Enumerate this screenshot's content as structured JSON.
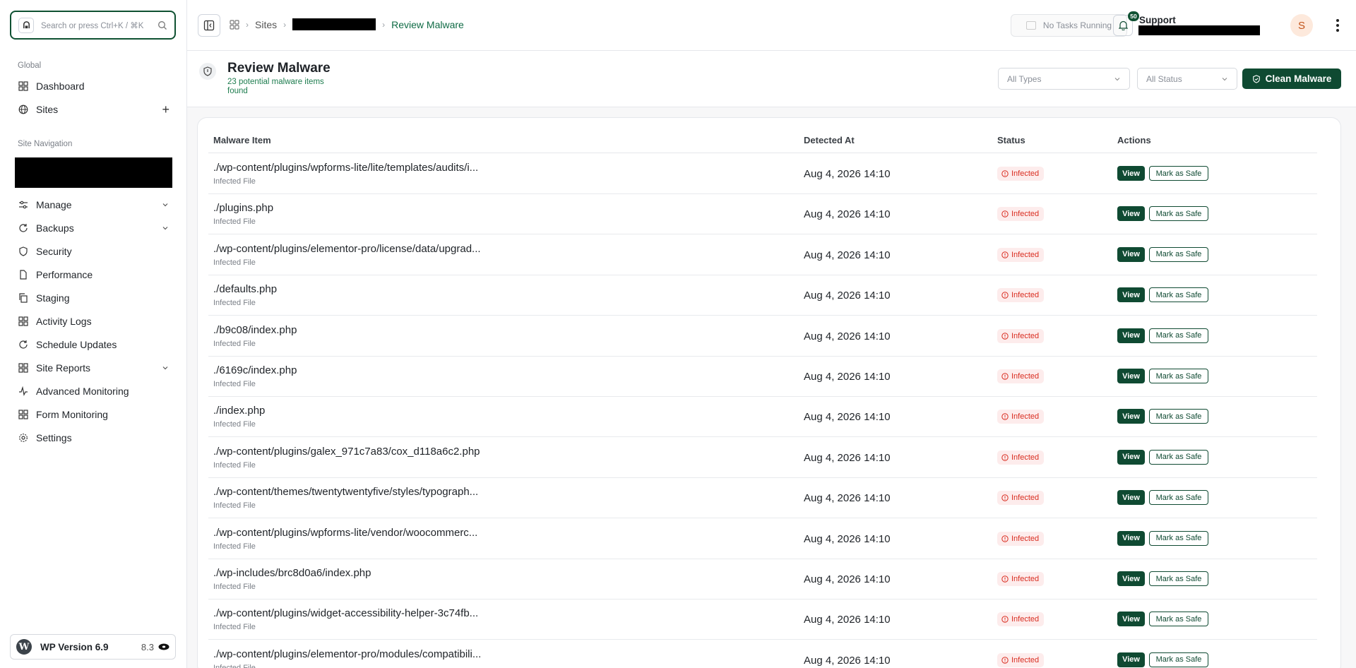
{
  "search": {
    "placeholder": "Search or press Ctrl+K / ⌘K"
  },
  "sidebar": {
    "global_label": "Global",
    "global_items": [
      {
        "label": "Dashboard",
        "icon": "grid-icon"
      },
      {
        "label": "Sites",
        "icon": "globe-icon",
        "action": "+"
      }
    ],
    "site_nav_label": "Site Navigation",
    "items": [
      {
        "label": "Manage",
        "icon": "sliders-icon",
        "expandable": true
      },
      {
        "label": "Backups",
        "icon": "refresh-icon",
        "expandable": true
      },
      {
        "label": "Security",
        "icon": "shield-icon"
      },
      {
        "label": "Performance",
        "icon": "document-icon"
      },
      {
        "label": "Staging",
        "icon": "copy-icon"
      },
      {
        "label": "Activity Logs",
        "icon": "grid-icon"
      },
      {
        "label": "Schedule Updates",
        "icon": "refresh-icon"
      },
      {
        "label": "Site Reports",
        "icon": "grid-icon",
        "expandable": true
      },
      {
        "label": "Advanced Monitoring",
        "icon": "activity-icon"
      },
      {
        "label": "Form Monitoring",
        "icon": "grid-icon"
      },
      {
        "label": "Settings",
        "icon": "gear-icon"
      }
    ],
    "footer": {
      "wp_label": "WP Version 6.9",
      "php_version": "8.3"
    }
  },
  "topbar": {
    "breadcrumb": {
      "sites": "Sites",
      "current": "Review Malware"
    },
    "tasks": "No Tasks Running",
    "notifications_count": "50",
    "user_name": "Support",
    "avatar_initial": "S"
  },
  "header": {
    "title": "Review Malware",
    "subtitle": "23 potential malware items found",
    "filter_type": "All Types",
    "filter_status": "All Status",
    "clean_button": "Clean Malware"
  },
  "table": {
    "columns": [
      "Malware Item",
      "Detected At",
      "Status",
      "Actions"
    ],
    "view_label": "View",
    "safe_label": "Mark as Safe",
    "rows": [
      {
        "path": "./wp-content/plugins/wpforms-lite/lite/templates/audits/i...",
        "type": "Infected File",
        "detected": "Aug 4, 2026 14:10",
        "status": "Infected"
      },
      {
        "path": "./plugins.php",
        "type": "Infected File",
        "detected": "Aug 4, 2026 14:10",
        "status": "Infected"
      },
      {
        "path": "./wp-content/plugins/elementor-pro/license/data/upgrad...",
        "type": "Infected File",
        "detected": "Aug 4, 2026 14:10",
        "status": "Infected"
      },
      {
        "path": "./defaults.php",
        "type": "Infected File",
        "detected": "Aug 4, 2026 14:10",
        "status": "Infected"
      },
      {
        "path": "./b9c08/index.php",
        "type": "Infected File",
        "detected": "Aug 4, 2026 14:10",
        "status": "Infected"
      },
      {
        "path": "./6169c/index.php",
        "type": "Infected File",
        "detected": "Aug 4, 2026 14:10",
        "status": "Infected"
      },
      {
        "path": "./index.php",
        "type": "Infected File",
        "detected": "Aug 4, 2026 14:10",
        "status": "Infected"
      },
      {
        "path": "./wp-content/plugins/galex_971c7a83/cox_d118a6c2.php",
        "type": "Infected File",
        "detected": "Aug 4, 2026 14:10",
        "status": "Infected"
      },
      {
        "path": "./wp-content/themes/twentytwentyfive/styles/typograph...",
        "type": "Infected File",
        "detected": "Aug 4, 2026 14:10",
        "status": "Infected"
      },
      {
        "path": "./wp-content/plugins/wpforms-lite/vendor/woocommerc...",
        "type": "Infected File",
        "detected": "Aug 4, 2026 14:10",
        "status": "Infected"
      },
      {
        "path": "./wp-includes/brc8d0a6/index.php",
        "type": "Infected File",
        "detected": "Aug 4, 2026 14:10",
        "status": "Infected"
      },
      {
        "path": "./wp-content/plugins/widget-accessibility-helper-3c74fb...",
        "type": "Infected File",
        "detected": "Aug 4, 2026 14:10",
        "status": "Infected"
      },
      {
        "path": "./wp-content/plugins/elementor-pro/modules/compatibili...",
        "type": "Infected File",
        "detected": "Aug 4, 2026 14:10",
        "status": "Infected"
      }
    ]
  },
  "colors": {
    "brand": "#0f4a32",
    "infected": "#d92d20",
    "accent_text": "#1e7d4f"
  }
}
